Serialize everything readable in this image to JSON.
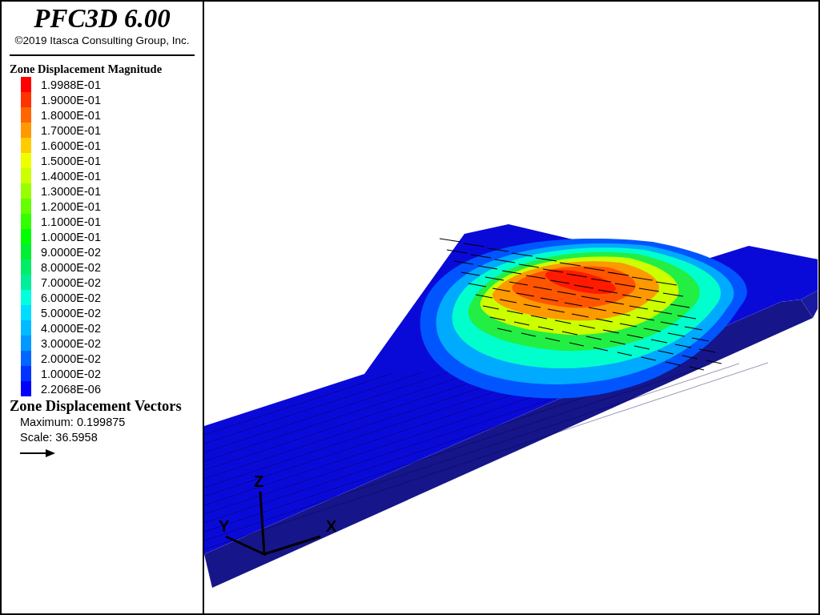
{
  "title": "PFC3D 6.00",
  "copyright": "©2019 Itasca Consulting Group, Inc.",
  "contour_legend": {
    "title": "Zone Displacement Magnitude",
    "entries": [
      {
        "label": "1.9988E-01",
        "color": "#ff0000"
      },
      {
        "label": "1.9000E-01",
        "color": "#ff3300"
      },
      {
        "label": "1.8000E-01",
        "color": "#ff6600"
      },
      {
        "label": "1.7000E-01",
        "color": "#ff9900"
      },
      {
        "label": "1.6000E-01",
        "color": "#ffcc00"
      },
      {
        "label": "1.5000E-01",
        "color": "#eeff00"
      },
      {
        "label": "1.4000E-01",
        "color": "#ccff00"
      },
      {
        "label": "1.3000E-01",
        "color": "#99ff00"
      },
      {
        "label": "1.2000E-01",
        "color": "#66ff00"
      },
      {
        "label": "1.1000E-01",
        "color": "#33ff00"
      },
      {
        "label": "1.0000E-01",
        "color": "#00ff00"
      },
      {
        "label": "9.0000E-02",
        "color": "#00ee33"
      },
      {
        "label": "8.0000E-02",
        "color": "#00ee66"
      },
      {
        "label": "7.0000E-02",
        "color": "#00ee99"
      },
      {
        "label": "6.0000E-02",
        "color": "#00ffdd"
      },
      {
        "label": "5.0000E-02",
        "color": "#00ddff"
      },
      {
        "label": "4.0000E-02",
        "color": "#00bbff"
      },
      {
        "label": "3.0000E-02",
        "color": "#0099ff"
      },
      {
        "label": "2.0000E-02",
        "color": "#0066ff"
      },
      {
        "label": "1.0000E-02",
        "color": "#0033ff"
      },
      {
        "label": "2.2068E-06",
        "color": "#0000ff"
      }
    ]
  },
  "vector_legend": {
    "title": "Zone Displacement Vectors",
    "maximum": "Maximum: 0.199875",
    "scale": "Scale: 36.5958"
  },
  "plot": {
    "axes": [
      {
        "label": "Z"
      },
      {
        "label": "Y"
      },
      {
        "label": "X"
      }
    ]
  }
}
